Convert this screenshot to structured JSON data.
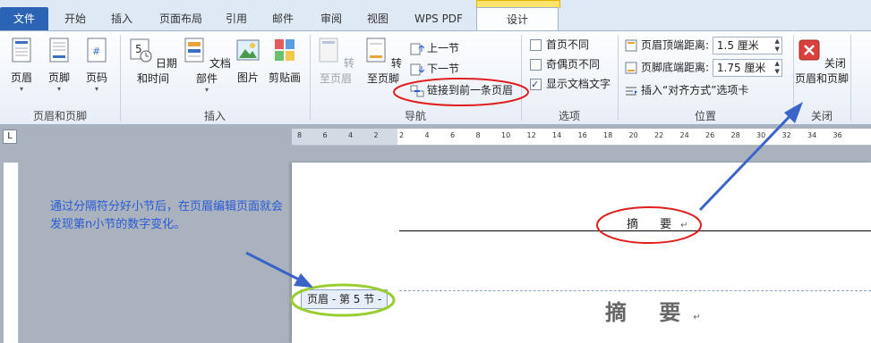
{
  "tabs": [
    "文件",
    "开始",
    "插入",
    "页面布局",
    "引用",
    "邮件",
    "审阅",
    "视图",
    "WPS PDF",
    "设计"
  ],
  "header_footer_group": {
    "label": "页眉和页脚",
    "header": "页眉",
    "footer": "页脚",
    "page_number": "页码"
  },
  "insert_group": {
    "label": "插入",
    "date_time": "日期和时间",
    "doc_parts": "文档部件",
    "picture": "图片",
    "clipart": "剪贴画"
  },
  "nav_group": {
    "label": "导航",
    "goto_header": "转至页眉",
    "goto_footer": "转至页脚",
    "prev_section": "上一节",
    "next_section": "下一节",
    "link_previous": "链接到前一条页眉"
  },
  "options_group": {
    "label": "选项",
    "diff_first": "首页不同",
    "diff_odd_even": "奇偶页不同",
    "show_doc_text": "显示文档文字"
  },
  "position_group": {
    "label": "位置",
    "header_from_top_label": "页眉顶端距离:",
    "header_from_top_value": "1.5 厘米",
    "footer_from_bottom_label": "页脚底端距离:",
    "footer_from_bottom_value": "1.75 厘米",
    "insert_align_tab": "插入“对齐方式”选项卡"
  },
  "close_group": {
    "label": "关闭",
    "close_line1": "关闭",
    "close_line2": "页眉和页脚"
  },
  "ruler_numbers": [
    "8",
    "6",
    "4",
    "2",
    "2",
    "4",
    "6",
    "8",
    "10",
    "12",
    "14",
    "16",
    "18",
    "20",
    "22",
    "24",
    "26",
    "28",
    "30",
    "32",
    "34",
    "36"
  ],
  "document": {
    "header_text": "摘 要",
    "body_title": "摘 要",
    "paragraph_mark": "↵",
    "header_tag": "页眉 - 第 5 节 -"
  },
  "annotation": "通过分隔符分好小节后，在页眉编辑页面就会发现第n小节的数字变化。",
  "colors": {
    "annotation": "#2a5bd7",
    "circle_red": "#e02020",
    "circle_green": "#9acd32",
    "arrow": "#3a64c8"
  }
}
